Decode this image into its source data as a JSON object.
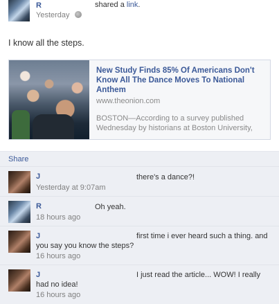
{
  "post": {
    "author": "R",
    "action_text": "shared a ",
    "action_link": "link",
    "timestamp": "Yesterday",
    "message": "I know all the steps."
  },
  "link_preview": {
    "title": "New Study Finds 85% Of Americans Don't Know All The Dance Moves To National Anthem",
    "domain": "www.theonion.com",
    "description": "BOSTON—According to a survey published Wednesday by historians at Boston University,"
  },
  "actions": {
    "share_label": "Share"
  },
  "comments": [
    {
      "author": "J",
      "text": "there's a dance?!",
      "time": "Yesterday at 9:07am"
    },
    {
      "author": "R",
      "text": "Oh yeah.",
      "time": "18 hours ago"
    },
    {
      "author": "J",
      "text": "first time i ever heard such a thing. and you say you know the steps?",
      "time": "16 hours ago"
    },
    {
      "author": "J",
      "text": "I just read the article... WOW! I really had no idea!",
      "time": "16 hours ago"
    }
  ],
  "icons": {
    "audience": "globe-icon"
  }
}
